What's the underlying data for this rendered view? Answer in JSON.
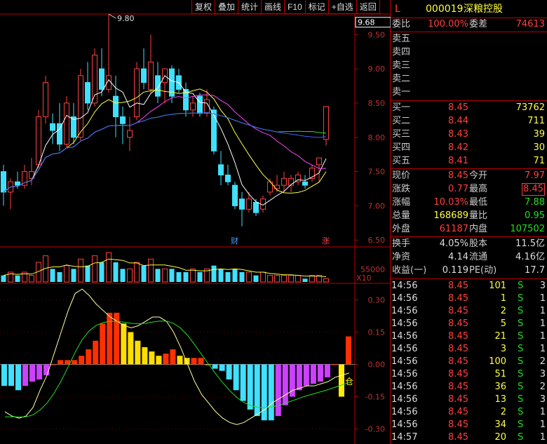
{
  "toolbar": [
    "复权",
    "叠加",
    "统计",
    "画线",
    "F10",
    "标记",
    "+自选",
    "返回"
  ],
  "stock": {
    "flag": "L",
    "code": "000019",
    "name": "深粮控股"
  },
  "order_book": {
    "ratio_label": "委比",
    "ratio": "100.00%",
    "diff_label": "委差",
    "diff": "74613",
    "asks": [
      {
        "label": "卖五"
      },
      {
        "label": "卖四"
      },
      {
        "label": "卖三"
      },
      {
        "label": "卖二"
      },
      {
        "label": "卖一"
      }
    ],
    "bids": [
      {
        "label": "买一",
        "price": "8.45",
        "volume": "73762"
      },
      {
        "label": "买二",
        "price": "8.44",
        "volume": "711"
      },
      {
        "label": "买三",
        "price": "8.43",
        "volume": "39"
      },
      {
        "label": "买四",
        "price": "8.42",
        "volume": "30"
      },
      {
        "label": "买五",
        "price": "8.41",
        "volume": "71"
      }
    ]
  },
  "stats": [
    {
      "l1": "现价",
      "v1": "8.45",
      "l2": "今开",
      "v2": "7.97"
    },
    {
      "l1": "涨跌",
      "v1": "0.77",
      "l2": "最高",
      "v2": "8.45"
    },
    {
      "l1": "涨幅",
      "v1": "10.03%",
      "l2": "最低",
      "v2": "7.88"
    },
    {
      "l1": "总量",
      "v1": "168689",
      "l2": "量比",
      "v2": "0.95"
    },
    {
      "l1": "外盘",
      "v1": "61187",
      "l2": "内盘",
      "v2": "107502"
    }
  ],
  "fundamentals": [
    {
      "l1": "换手",
      "v1": "4.05%",
      "l2": "股本",
      "v2": "11.5亿"
    },
    {
      "l1": "净资",
      "v1": "4.14",
      "l2": "流通",
      "v2": "4.16亿"
    },
    {
      "l1": "收益(一)",
      "v1": "0.119",
      "l2": "PE(动)",
      "v2": "17.7"
    }
  ],
  "ticks": [
    {
      "time": "14:56",
      "price": "8.45",
      "vol": "101",
      "bs": "S",
      "count": "3"
    },
    {
      "time": "14:56",
      "price": "8.45",
      "vol": "1",
      "bs": "S",
      "count": "1"
    },
    {
      "time": "14:56",
      "price": "8.45",
      "vol": "2",
      "bs": "S",
      "count": "1"
    },
    {
      "time": "14:56",
      "price": "8.45",
      "vol": "5",
      "bs": "S",
      "count": "1"
    },
    {
      "time": "14:56",
      "price": "8.45",
      "vol": "21",
      "bs": "S",
      "count": "1"
    },
    {
      "time": "14:56",
      "price": "8.45",
      "vol": "3",
      "bs": "S",
      "count": "1"
    },
    {
      "time": "14:56",
      "price": "8.45",
      "vol": "100",
      "bs": "S",
      "count": "2"
    },
    {
      "time": "14:56",
      "price": "8.45",
      "vol": "51",
      "bs": "S",
      "count": "3"
    },
    {
      "time": "14:56",
      "price": "8.45",
      "vol": "36",
      "bs": "S",
      "count": "2"
    },
    {
      "time": "14:56",
      "price": "8.45",
      "vol": "13",
      "bs": "S",
      "count": "3"
    },
    {
      "time": "14:56",
      "price": "8.45",
      "vol": "2",
      "bs": "S",
      "count": "1"
    },
    {
      "time": "14:56",
      "price": "8.45",
      "vol": "34",
      "bs": "S",
      "count": "1"
    },
    {
      "time": "14:57",
      "price": "8.45",
      "vol": "20",
      "bs": "S",
      "count": "1"
    }
  ],
  "chart_data": {
    "type": "candlestick",
    "price_axis": [
      "9.50",
      "9.00",
      "8.50",
      "8.00",
      "7.50",
      "7.00",
      "6.50"
    ],
    "ylim": [
      6.4,
      9.8
    ],
    "current_price_label": "9.68",
    "high_marker": "9.80",
    "markers": [
      {
        "text": "财",
        "index": 33
      },
      {
        "text": "涨",
        "index": 46
      }
    ],
    "candles": [
      {
        "o": 7.5,
        "h": 7.6,
        "l": 7.0,
        "c": 7.2
      },
      {
        "o": 7.2,
        "h": 7.4,
        "l": 6.95,
        "c": 7.35
      },
      {
        "o": 7.35,
        "h": 7.5,
        "l": 7.25,
        "c": 7.3
      },
      {
        "o": 7.3,
        "h": 7.6,
        "l": 7.25,
        "c": 7.5
      },
      {
        "o": 7.4,
        "h": 7.7,
        "l": 7.3,
        "c": 7.5
      },
      {
        "o": 7.6,
        "h": 8.4,
        "l": 7.55,
        "c": 8.3
      },
      {
        "o": 8.3,
        "h": 8.9,
        "l": 8.2,
        "c": 8.8
      },
      {
        "o": 8.2,
        "h": 8.35,
        "l": 7.9,
        "c": 8.1
      },
      {
        "o": 8.2,
        "h": 8.5,
        "l": 7.8,
        "c": 7.9
      },
      {
        "o": 7.9,
        "h": 8.6,
        "l": 7.85,
        "c": 8.5
      },
      {
        "o": 8.3,
        "h": 8.5,
        "l": 7.9,
        "c": 8.0
      },
      {
        "o": 8.0,
        "h": 9.0,
        "l": 7.95,
        "c": 8.9
      },
      {
        "o": 8.8,
        "h": 9.1,
        "l": 8.4,
        "c": 8.5
      },
      {
        "o": 8.5,
        "h": 9.3,
        "l": 8.45,
        "c": 9.2
      },
      {
        "o": 9.0,
        "h": 9.3,
        "l": 8.6,
        "c": 8.7
      },
      {
        "o": 8.7,
        "h": 9.8,
        "l": 8.65,
        "c": 8.9
      },
      {
        "o": 8.6,
        "h": 8.9,
        "l": 8.0,
        "c": 8.3
      },
      {
        "o": 8.3,
        "h": 8.45,
        "l": 7.9,
        "c": 8.2
      },
      {
        "o": 8.0,
        "h": 8.3,
        "l": 7.8,
        "c": 8.1
      },
      {
        "o": 8.3,
        "h": 9.1,
        "l": 8.25,
        "c": 9.0
      },
      {
        "o": 9.0,
        "h": 9.3,
        "l": 8.7,
        "c": 8.8
      },
      {
        "o": 8.7,
        "h": 9.5,
        "l": 8.65,
        "c": 9.1
      },
      {
        "o": 8.9,
        "h": 9.1,
        "l": 8.5,
        "c": 8.6
      },
      {
        "o": 8.8,
        "h": 9.0,
        "l": 8.5,
        "c": 9.0
      },
      {
        "o": 9.0,
        "h": 9.05,
        "l": 8.5,
        "c": 8.6
      },
      {
        "o": 8.9,
        "h": 9.0,
        "l": 8.65,
        "c": 8.7
      },
      {
        "o": 8.7,
        "h": 8.8,
        "l": 8.3,
        "c": 8.4
      },
      {
        "o": 8.4,
        "h": 8.6,
        "l": 8.3,
        "c": 8.5
      },
      {
        "o": 8.6,
        "h": 8.65,
        "l": 8.3,
        "c": 8.35
      },
      {
        "o": 8.35,
        "h": 8.7,
        "l": 8.3,
        "c": 8.55
      },
      {
        "o": 8.4,
        "h": 8.45,
        "l": 7.75,
        "c": 7.8
      },
      {
        "o": 7.6,
        "h": 7.8,
        "l": 7.3,
        "c": 7.45
      },
      {
        "o": 7.45,
        "h": 7.6,
        "l": 7.3,
        "c": 7.35
      },
      {
        "o": 7.3,
        "h": 7.35,
        "l": 6.95,
        "c": 7.0
      },
      {
        "o": 7.1,
        "h": 7.2,
        "l": 6.7,
        "c": 6.95
      },
      {
        "o": 6.95,
        "h": 7.2,
        "l": 6.9,
        "c": 7.1
      },
      {
        "o": 7.05,
        "h": 7.1,
        "l": 6.85,
        "c": 6.9
      },
      {
        "o": 6.95,
        "h": 7.15,
        "l": 6.9,
        "c": 7.1
      },
      {
        "o": 7.2,
        "h": 7.4,
        "l": 7.15,
        "c": 7.35
      },
      {
        "o": 7.25,
        "h": 7.45,
        "l": 7.2,
        "c": 7.3
      },
      {
        "o": 7.3,
        "h": 7.5,
        "l": 7.2,
        "c": 7.4
      },
      {
        "o": 7.3,
        "h": 7.45,
        "l": 7.2,
        "c": 7.4
      },
      {
        "o": 7.35,
        "h": 7.5,
        "l": 7.3,
        "c": 7.45
      },
      {
        "o": 7.35,
        "h": 7.45,
        "l": 7.25,
        "c": 7.3
      },
      {
        "o": 7.4,
        "h": 7.6,
        "l": 7.35,
        "c": 7.55
      },
      {
        "o": 7.6,
        "h": 7.7,
        "l": 7.35,
        "c": 7.7
      },
      {
        "o": 7.97,
        "h": 8.45,
        "l": 7.88,
        "c": 8.45
      }
    ],
    "volume_axis_label": "55000",
    "volume_unit": "X10",
    "volumes": [
      2,
      3,
      2,
      3,
      2,
      6,
      8,
      4,
      3,
      5,
      4,
      7,
      5,
      8,
      6,
      9,
      6,
      4,
      4,
      6,
      5,
      7,
      4,
      4,
      4,
      3,
      3,
      4,
      3,
      4,
      5,
      4,
      3,
      4,
      3,
      3,
      2,
      3,
      2,
      2,
      2,
      2,
      2,
      1,
      2,
      2,
      1
    ],
    "macd_axis": [
      "0.30",
      "0.15",
      "0.00",
      "-0.15",
      "-0.30"
    ],
    "macd_label": "仓",
    "macd_ylim": [
      -0.37,
      0.37
    ],
    "macd_hist": [
      -0.1,
      -0.1,
      -0.12,
      -0.1,
      -0.08,
      -0.07,
      -0.05,
      0.0,
      0.02,
      0.02,
      0.02,
      0.04,
      0.07,
      0.11,
      0.19,
      0.24,
      0.24,
      0.19,
      0.15,
      0.11,
      0.08,
      0.06,
      0.04,
      0.05,
      0.07,
      0.04,
      0.03,
      0.03,
      0.03,
      0.0,
      -0.02,
      -0.03,
      -0.07,
      -0.12,
      -0.17,
      -0.21,
      -0.24,
      -0.26,
      -0.26,
      -0.24,
      -0.19,
      -0.15,
      -0.12,
      -0.1,
      -0.09,
      -0.08,
      -0.06,
      0.0,
      -0.15,
      0.13
    ]
  }
}
